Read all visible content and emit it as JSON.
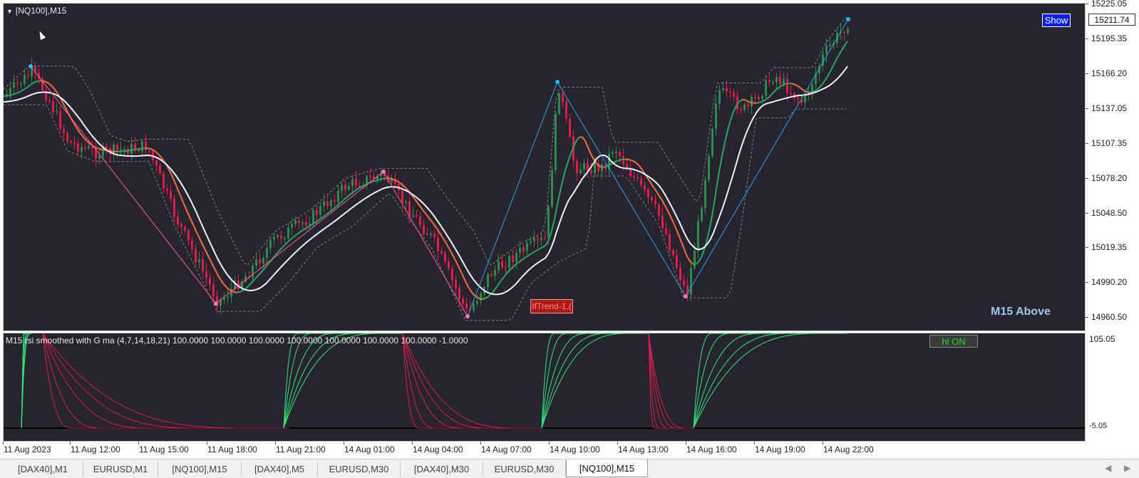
{
  "main_chart": {
    "symbol_label": "[NQ100],M15",
    "show_button": "Show",
    "current_price": "15211.74",
    "trend_label": "IfTrend-1.(",
    "status_text": "M15 Above",
    "price_axis": [
      "15225.05",
      "15195.35",
      "15166.20",
      "15137.05",
      "15107.35",
      "15078.20",
      "15048.50",
      "15019.35",
      "14990.20",
      "14960.50"
    ]
  },
  "sub_chart": {
    "indicator_label": "M15 rsi smoothed with G ma (4,7,14,18,21) 100.0000 100.0000 100.0000 100.0000 100.0000 100.0000 100.0000 -1.0000",
    "hl_button": "hl ON",
    "axis_top": "105.05",
    "axis_bottom": "-5.05"
  },
  "time_axis": [
    "11 Aug 2023",
    "11 Aug 12:00",
    "11 Aug 15:00",
    "11 Aug 18:00",
    "11 Aug 21:00",
    "14 Aug 01:00",
    "14 Aug 04:00",
    "14 Aug 07:00",
    "14 Aug 10:00",
    "14 Aug 13:00",
    "14 Aug 16:00",
    "14 Aug 19:00",
    "14 Aug 22:00"
  ],
  "tabs": [
    {
      "label": "[DAX40],M1",
      "active": false
    },
    {
      "label": "EURUSD,M1",
      "active": false
    },
    {
      "label": "[NQ100],M15",
      "active": false
    },
    {
      "label": "[DAX40],M5",
      "active": false
    },
    {
      "label": "EURUSD,M30",
      "active": false
    },
    {
      "label": "[DAX40],M30",
      "active": false
    },
    {
      "label": "EURUSD,M30",
      "active": false
    },
    {
      "label": "[NQ100],M15",
      "active": true
    }
  ],
  "nav": {
    "left_icon": "arrow-left-icon",
    "right_icon": "arrow-right-icon"
  },
  "colors": {
    "background": "#27242f",
    "bull_candle": "#2e8b4e",
    "bear_candle": "#e01e4a",
    "ma_fast": "#ff6a3c",
    "ma_slow": "#e8f4ff",
    "zigzag_up": "#1ea8e8",
    "zigzag_down": "#ff5a9a",
    "channel": "#8c8c8c",
    "rsi_up": "#2ee87a",
    "rsi_down": "#d8204a"
  }
}
